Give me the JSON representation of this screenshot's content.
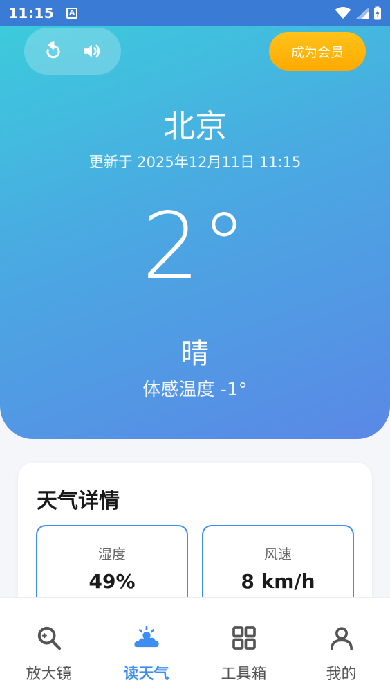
{
  "status_bar": {
    "time": "11:15",
    "notification_letter": "A"
  },
  "header": {
    "refresh_icon": "refresh-icon",
    "speaker_icon": "speaker-icon",
    "vip_label": "成为会员"
  },
  "weather": {
    "city": "北京",
    "updated": "更新于 2025年12月11日 11:15",
    "temperature": "2°",
    "condition": "晴",
    "feels_like": "体感温度 -1°"
  },
  "details": {
    "title": "天气详情",
    "items": [
      {
        "label": "湿度",
        "value": "49%"
      },
      {
        "label": "风速",
        "value": "8 km/h"
      }
    ]
  },
  "nav": {
    "active_index": 1,
    "items": [
      {
        "label": "放大镜",
        "icon": "magnifier-icon"
      },
      {
        "label": "读天气",
        "icon": "weather-icon"
      },
      {
        "label": "工具箱",
        "icon": "grid-icon"
      },
      {
        "label": "我的",
        "icon": "person-icon"
      }
    ]
  },
  "colors": {
    "accent": "#3d8ef0",
    "vip": "#ffb300",
    "hero_start": "#3ccbdc",
    "hero_end": "#5a88e6"
  }
}
